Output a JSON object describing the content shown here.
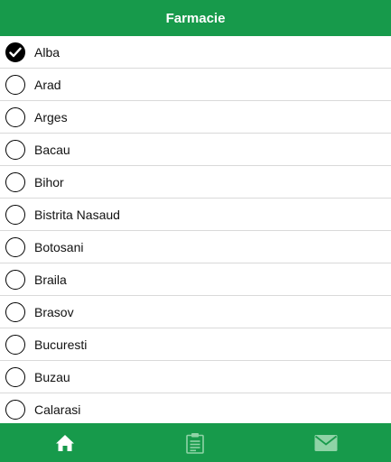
{
  "header": {
    "title": "Farmacie"
  },
  "list": {
    "items": [
      {
        "label": "Alba",
        "checked": true
      },
      {
        "label": "Arad",
        "checked": false
      },
      {
        "label": "Arges",
        "checked": false
      },
      {
        "label": "Bacau",
        "checked": false
      },
      {
        "label": "Bihor",
        "checked": false
      },
      {
        "label": "Bistrita Nasaud",
        "checked": false
      },
      {
        "label": "Botosani",
        "checked": false
      },
      {
        "label": "Braila",
        "checked": false
      },
      {
        "label": "Brasov",
        "checked": false
      },
      {
        "label": "Bucuresti",
        "checked": false
      },
      {
        "label": "Buzau",
        "checked": false
      },
      {
        "label": "Calarasi",
        "checked": false
      }
    ]
  },
  "tabbar": {
    "tabs": [
      {
        "icon": "home-icon",
        "active": true
      },
      {
        "icon": "clipboard-icon",
        "active": false
      },
      {
        "icon": "mail-icon",
        "active": false
      }
    ]
  },
  "colors": {
    "brand_green": "#179a4b",
    "active_icon": "#ffffff",
    "inactive_icon": "#8fd3a6",
    "divider": "#d9d9d9"
  }
}
